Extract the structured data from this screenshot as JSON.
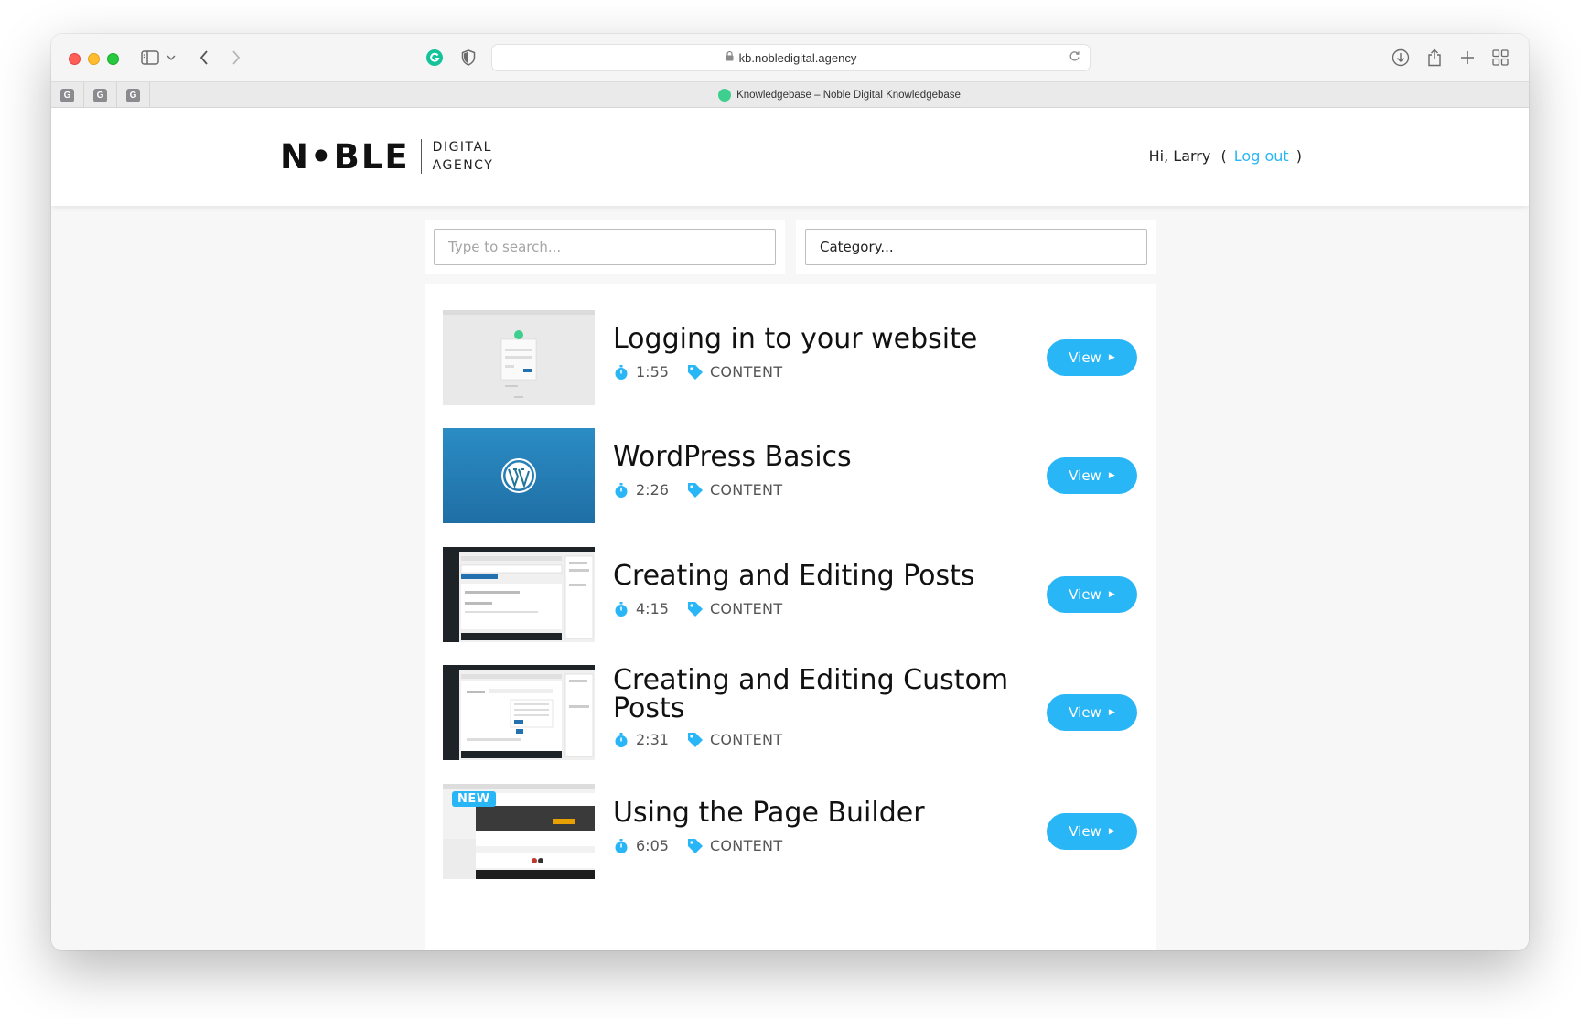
{
  "browser": {
    "url": "kb.nobledigital.agency",
    "tab_title": "Knowledgebase – Noble Digital Knowledgebase",
    "pinned_tabs": [
      "G",
      "G",
      "G"
    ]
  },
  "header": {
    "logo_word": "N•BLE",
    "logo_sub_line1": "DIGITAL",
    "logo_sub_line2": "AGENCY",
    "greeting": "Hi, Larry",
    "paren_open": "(",
    "logout_label": "Log out",
    "paren_close": ")"
  },
  "filters": {
    "search_placeholder": "Type to search...",
    "category_label": "Category..."
  },
  "items": [
    {
      "title": "Logging in to your website",
      "duration": "1:55",
      "category": "CONTENT",
      "view_label": "View",
      "thumb": "login-screen"
    },
    {
      "title": "WordPress Basics",
      "duration": "2:26",
      "category": "CONTENT",
      "view_label": "View",
      "thumb": "wordpress-logo"
    },
    {
      "title": "Creating and Editing Posts",
      "duration": "4:15",
      "category": "CONTENT",
      "view_label": "View",
      "thumb": "wp-editor"
    },
    {
      "title": "Creating and Editing Custom Posts",
      "duration": "2:31",
      "category": "CONTENT",
      "view_label": "View",
      "thumb": "wp-custom-posts"
    },
    {
      "title": "Using the Page Builder",
      "duration": "6:05",
      "category": "CONTENT",
      "view_label": "View",
      "thumb": "page-builder",
      "badge": "NEW"
    }
  ],
  "colors": {
    "accent": "#29b6f6",
    "text": "#111111",
    "page_bg": "#f7f7f7"
  }
}
